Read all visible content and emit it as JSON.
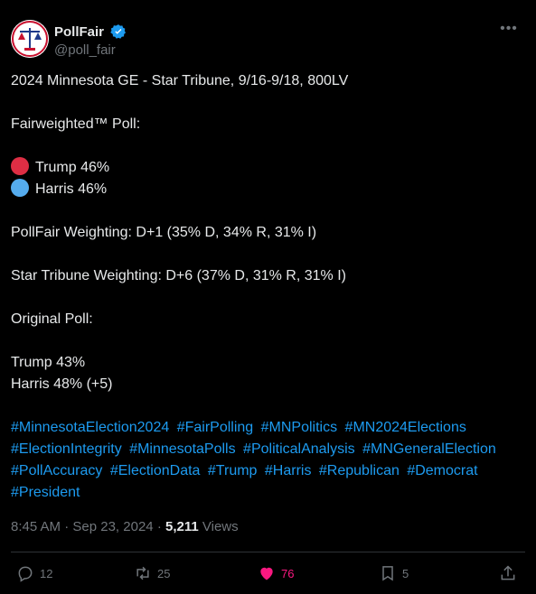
{
  "author": {
    "display_name": "PollFair",
    "handle": "@poll_fair"
  },
  "tweet": {
    "line1": "2024 Minnesota GE - Star Tribune, 9/16-9/18, 800LV",
    "line2": "Fairweighted™ Poll:",
    "trump_fw": "Trump 46%",
    "harris_fw": "Harris 46%",
    "pollfair_weighting": "PollFair Weighting: D+1 (35% D, 34% R, 31% I)",
    "startribune_weighting": "Star Tribune Weighting: D+6 (37% D, 31% R, 31% I)",
    "original_label": "Original Poll:",
    "trump_orig": "Trump 43%",
    "harris_orig": "Harris 48% (+5)",
    "hashtags": [
      "#MinnesotaElection2024",
      "#FairPolling",
      "#MNPolitics",
      "#MN2024Elections",
      "#ElectionIntegrity",
      "#MinnesotaPolls",
      "#PoliticalAnalysis",
      "#MNGeneralElection",
      "#PollAccuracy",
      "#ElectionData",
      "#Trump",
      "#Harris",
      "#Republican",
      "#Democrat",
      "#President"
    ]
  },
  "meta": {
    "time": "8:45 AM",
    "date": "Sep 23, 2024",
    "views_count": "5,211",
    "views_label": "Views"
  },
  "actions": {
    "replies": "12",
    "reposts": "25",
    "likes": "76",
    "bookmarks": "5"
  },
  "colors": {
    "red_dot": "#dd2e44",
    "blue_dot": "#55acee",
    "link": "#1d9bf0",
    "like": "#f91880"
  }
}
